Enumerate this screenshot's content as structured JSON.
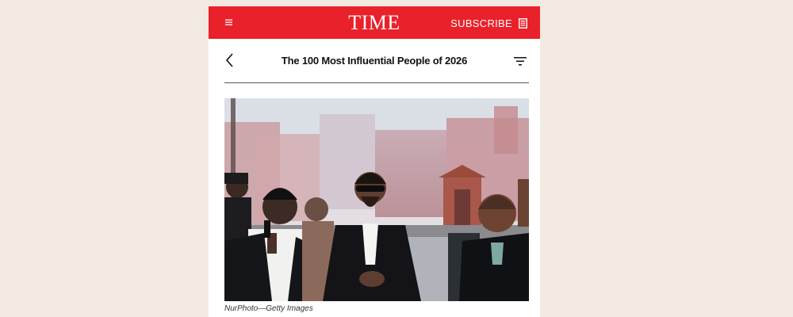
{
  "brand": {
    "logo_text": "TIME",
    "accent_color": "#e9212b"
  },
  "topbar": {
    "menu_icon": "hamburger-icon",
    "subscribe_label": "SUBSCRIBE",
    "subscribe_icon": "magazine-icon"
  },
  "header": {
    "back_icon": "chevron-left-icon",
    "title": "The 100 Most Influential People of 2026",
    "filter_icon": "filter-icon"
  },
  "article": {
    "photo_caption": "NurPhoto—Getty Images"
  }
}
